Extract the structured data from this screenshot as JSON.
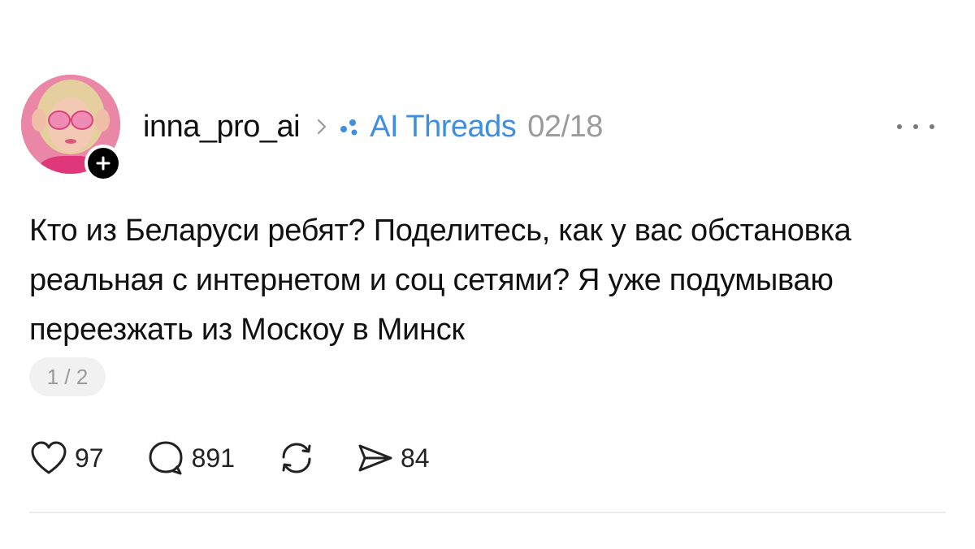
{
  "post": {
    "username": "inna_pro_ai",
    "community": "AI Threads",
    "date": "02/18",
    "text": "Кто из Беларуси ребят? Поделитесь, как у вас обстановка реальная с интернетом и соц сетями? Я уже подумываю переезжать из Москоу в Минск",
    "page_indicator": "1 / 2"
  },
  "actions": {
    "likes": "97",
    "replies": "891",
    "reposts": "",
    "shares": "84"
  },
  "icons": {
    "avatar": "avatar-photo",
    "follow": "plus-icon",
    "chevron": "chevron-right-icon",
    "community": "community-dots-icon",
    "more": "more-dots-icon",
    "like": "heart-icon",
    "reply": "comment-icon",
    "repost": "repost-icon",
    "share": "send-icon"
  },
  "colors": {
    "community_blue": "#3f8fe0",
    "date_gray": "#9b9b9b",
    "text": "#111111"
  }
}
